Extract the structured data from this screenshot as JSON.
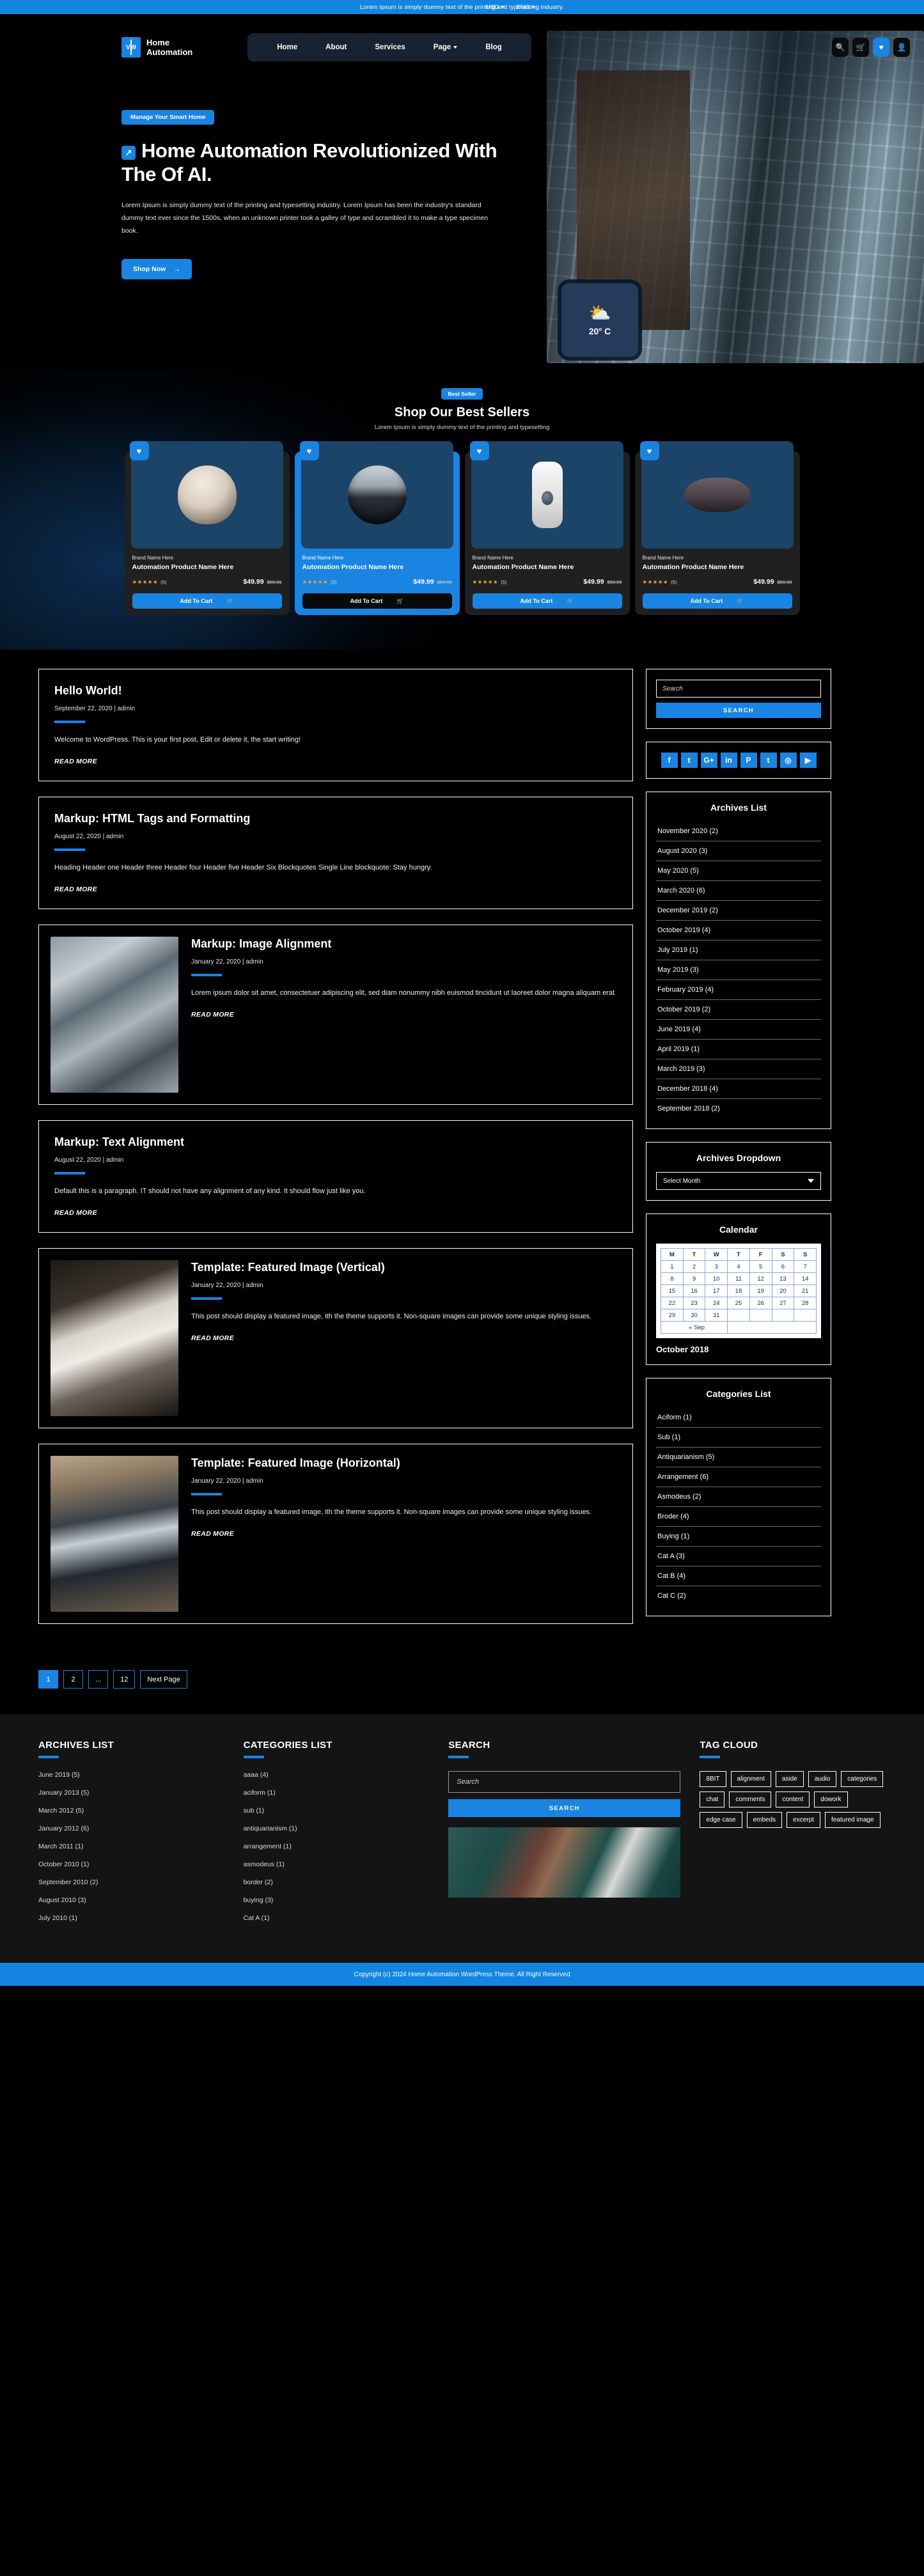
{
  "topbar": {
    "message": "Lorem Ipsum is simply dummy text of the printing and typesetting industry.",
    "currency": "USD",
    "language": "ENG"
  },
  "header": {
    "brand_line1": "Home",
    "brand_line2": "Automation",
    "logo_text": "VW",
    "nav": [
      {
        "label": "Home"
      },
      {
        "label": "About"
      },
      {
        "label": "Services"
      },
      {
        "label": "Page",
        "caret": true
      },
      {
        "label": "Blog"
      }
    ],
    "icons": [
      "search-icon",
      "cart-icon",
      "wishlist-icon",
      "account-icon"
    ]
  },
  "hero": {
    "pill": "Manage Your Smart Home",
    "arrow_glyph": "↗",
    "heading": "Home Automation Revolutionized With The Of AI.",
    "paragraph": "Lorem Ipsum is simply dummy text of the printing and typesetting industry. Lorem Ipsum has been the industry's standard dummy text ever since the 1500s, when an unknown printer took a galley of type and scrambled it to make a type specimen book.",
    "cta": "Shop Now",
    "cta_arrow": "→",
    "weather_icon": "⛅",
    "weather_temp": "20",
    "weather_unit": "C",
    "weather_degree": "o"
  },
  "bestsellers": {
    "pill": "Best Seller",
    "title": "Shop Our Best Sellers",
    "subtitle": "Lorem Ipsum is simply dummy text of the printing and typesetting",
    "products": [
      {
        "brand": "Brand Name Here",
        "name": "Automation Product Name Here",
        "stars": "★★★★★",
        "count": "(5)",
        "price": "$49.99",
        "old_price": "$59.99",
        "cta": "Add To Cart",
        "shape": "shape-cam",
        "featured": false
      },
      {
        "brand": "Brand Name Here",
        "name": "Automation Product Name Here",
        "stars": "★★★★★",
        "count": "(5)",
        "price": "$49.99",
        "old_price": "$59.99",
        "cta": "Add To Cart",
        "shape": "shape-vac",
        "featured": true
      },
      {
        "brand": "Brand Name Here",
        "name": "Automation Product Name Here",
        "stars": "★★★★★",
        "count": "(5)",
        "price": "$49.99",
        "old_price": "$59.99",
        "cta": "Add To Cart",
        "shape": "shape-bell",
        "featured": false
      },
      {
        "brand": "Brand Name Here",
        "name": "Automation Product Name Here",
        "stars": "★★★★★",
        "count": "(5)",
        "price": "$49.99",
        "old_price": "$59.99",
        "cta": "Add To Cart",
        "shape": "shape-speaker",
        "featured": false
      }
    ]
  },
  "posts": [
    {
      "title": "Hello World!",
      "meta": "September 22, 2020 | admin",
      "body": "Welcome to WordPress. This is your first post, Edit or delete it, the start writing!",
      "read_more": "READ MORE",
      "image": null
    },
    {
      "title": "Markup: HTML Tags and Formatting",
      "meta": "August 22, 2020 | admin",
      "body": "Heading Header one Header three Header four Header five Header Six Blockquotes Single Line blockquote: Stay hungry.",
      "read_more": "READ MORE",
      "image": null
    },
    {
      "title": "Markup: Image Alignment",
      "meta": "January 22, 2020 | admin",
      "body": "Lorem ipsum dolor sit amet, consectetuer adipiscing elit, sed diam nonummy nibh euismod tincidunt ut laoreet dolor magna aliquam erat",
      "read_more": "READ MORE",
      "image": "thumb-cam"
    },
    {
      "title": "Markup: Text Alignment",
      "meta": "August 22, 2020 | admin",
      "body": "Default this is a paragraph. IT should not have any alignment of any kind. It should flow just like you.",
      "read_more": "READ MORE",
      "image": null
    },
    {
      "title": "Template: Featured Image (Vertical)",
      "meta": "January 22, 2020 | admin",
      "body": "This post should display a featured image, ith the theme supports it. Non-square images can provide some unique styling issues.",
      "read_more": "READ MORE",
      "image": "thumb-remote"
    },
    {
      "title": "Template: Featured Image (Horizontal)",
      "meta": "January 22, 2020 | admin",
      "body": "This post should display a featured image, ith the theme supports it. Non-square images can provide some unique styling issues.",
      "read_more": "READ MORE",
      "image": "thumb-vac"
    }
  ],
  "sidebar": {
    "search": {
      "placeholder": "Search",
      "button": "SEARCH"
    },
    "socials": [
      "f",
      "t",
      "G+",
      "in",
      "P",
      "t",
      "◎",
      "▶"
    ],
    "archives_title": "Archives List",
    "archives": [
      "November 2020 (2)",
      "August 2020 (3)",
      "May 2020 (5)",
      "March 2020 (6)",
      "December 2019 (2)",
      "October 2019 (4)",
      "July 2019 (1)",
      "May 2019 (3)",
      "February 2019 (4)",
      "October 2019 (2)",
      "June 2019 (4)",
      "April 2019 (1)",
      "March 2019 (3)",
      "December 2018 (4)",
      "September 2018 (2)"
    ],
    "dropdown_title": "Archives Dropdown",
    "dropdown_value": "Select Month",
    "calendar_title": "Calendar",
    "calendar_days": [
      "M",
      "T",
      "W",
      "T",
      "F",
      "S",
      "S"
    ],
    "calendar_weeks": [
      [
        "1",
        "2",
        "3",
        "4",
        "5",
        "6",
        "7"
      ],
      [
        "8",
        "9",
        "10",
        "11",
        "12",
        "13",
        "14"
      ],
      [
        "15",
        "16",
        "17",
        "18",
        "19",
        "20",
        "21"
      ],
      [
        "22",
        "23",
        "24",
        "25",
        "26",
        "27",
        "28"
      ],
      [
        "29",
        "30",
        "31",
        "",
        "",
        "",
        ""
      ]
    ],
    "calendar_prev": "« Sep",
    "calendar_month": "October 2018",
    "categories_title": "Categories List",
    "categories": [
      "Aciform (1)",
      "Sub (1)",
      "Antiquarianism (5)",
      "Arrangement (6)",
      "Asmodeus (2)",
      "Broder (4)",
      "Buying (1)",
      "Cat A (3)",
      "Cat B (4)",
      "Cat C (2)"
    ]
  },
  "pagination": {
    "pages": [
      "1",
      "2",
      "...",
      "12"
    ],
    "next": "Next Page",
    "active": "1"
  },
  "footer": {
    "archives_title": "ARCHIVES LIST",
    "archives": [
      "June 2019 (5)",
      "January  2013 (5)",
      "March 2012 (5)",
      "January  2012 (6)",
      "March  2011 (1)",
      "October 2010 (1)",
      "September 2010 (2)",
      "August 2010 (3)",
      "July 2010 (1)"
    ],
    "categories_title": "CATEGORIES LIST",
    "categories": [
      "aaaa (4)",
      "aciform (1)",
      "sub (1)",
      "antiquarianism (1)",
      "arrangement (1)",
      "asmodeus (1)",
      "border (2)",
      "buying (3)",
      "Cat A (1)"
    ],
    "search_title": "SEARCH",
    "search_placeholder": "Search",
    "search_button": "SEARCH",
    "tagcloud_title": "TAG CLOUD",
    "tags": [
      "8BIT",
      "alignment",
      "aside",
      "audio",
      "categories",
      "chat",
      "comments",
      "content",
      "dowork",
      "edge case",
      "embeds",
      "excerpt",
      "featured image"
    ],
    "copyright": "Copyright (c) 2024 Home Automation WordPress Theme. All Right Reserved"
  },
  "colors": {
    "accent": "#1a84e2",
    "topbar": "#1385e0",
    "dark": "#000000",
    "footer_bg": "#141414"
  }
}
